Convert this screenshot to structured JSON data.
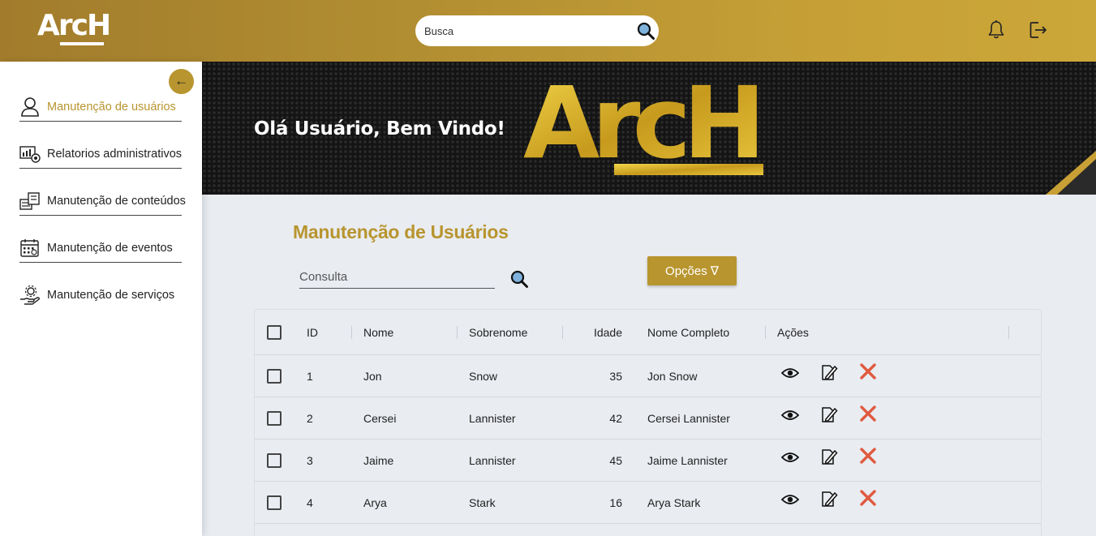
{
  "header": {
    "logo_text": "ArcH",
    "search_placeholder": "Busca"
  },
  "icons": {
    "search": "search-icon",
    "bell": "bell-icon",
    "logout": "logout-icon"
  },
  "sidebar": {
    "collapse_label": "←",
    "items": [
      {
        "label": "Manutenção de usuários",
        "icon": "user-icon",
        "active": true
      },
      {
        "label": "Relatorios administrativos",
        "icon": "report-icon",
        "active": false
      },
      {
        "label": "Manutenção de conteúdos",
        "icon": "content-icon",
        "active": false
      },
      {
        "label": "Manutenção de eventos",
        "icon": "calendar-icon",
        "active": false
      },
      {
        "label": "Manutenção de serviços",
        "icon": "service-icon",
        "active": false
      }
    ]
  },
  "banner": {
    "greeting": "Olá Usuário, Bem Vindo!",
    "logo_text": "ArcH"
  },
  "main": {
    "title": "Manutenção de Usuários",
    "consulta_placeholder": "Consulta",
    "options_label": "Opções ∇"
  },
  "table": {
    "columns": [
      "ID",
      "Nome",
      "Sobrenome",
      "Idade",
      "Nome Completo",
      "Ações"
    ],
    "rows": [
      {
        "id": "1",
        "nome": "Jon",
        "sobrenome": "Snow",
        "idade": "35",
        "completo": "Jon Snow"
      },
      {
        "id": "2",
        "nome": "Cersei",
        "sobrenome": "Lannister",
        "idade": "42",
        "completo": "Cersei Lannister"
      },
      {
        "id": "3",
        "nome": "Jaime",
        "sobrenome": "Lannister",
        "idade": "45",
        "completo": "Jaime Lannister"
      },
      {
        "id": "4",
        "nome": "Arya",
        "sobrenome": "Stark",
        "idade": "16",
        "completo": "Arya Stark"
      }
    ]
  },
  "colors": {
    "accent": "#b8952f",
    "delete": "#e05a3f"
  }
}
